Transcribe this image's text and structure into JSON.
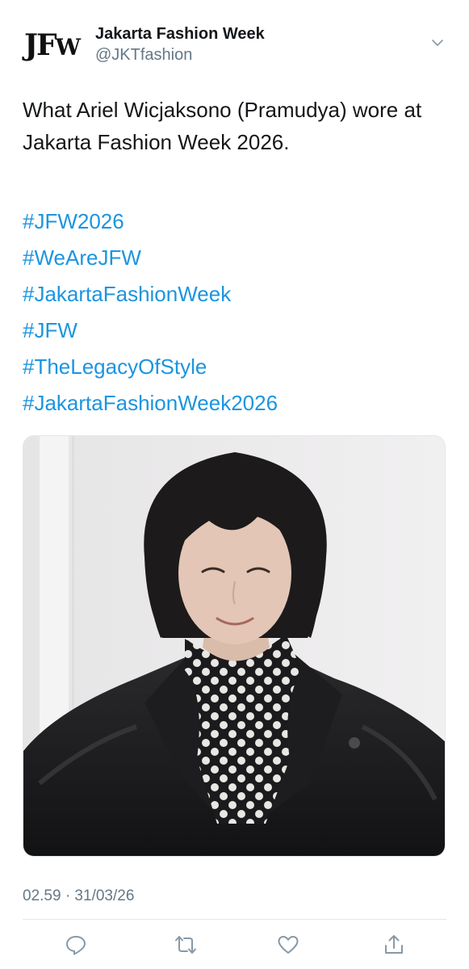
{
  "account": {
    "avatar_logo_big": "JF",
    "avatar_logo_small": "W",
    "display_name": "Jakarta Fashion Week",
    "handle": "@JKTfashion"
  },
  "tweet": {
    "text": "What Ariel Wicjaksono (Pramudya) wore at Jakarta Fashion Week 2026.",
    "hashtags": [
      "#JFW2026",
      "#WeAreJFW",
      "#JakartaFashionWeek",
      "#JFW",
      "#TheLegacyOfStyle",
      "#JakartaFashionWeek2026"
    ],
    "timestamp": "02.59 · 31/03/26"
  },
  "icons": {
    "menu": "chevron-down-icon",
    "reply": "reply-icon",
    "retweet": "retweet-icon",
    "like": "heart-icon",
    "share": "share-icon"
  },
  "colors": {
    "link": "#1b95e0",
    "secondary": "#657786",
    "text": "#14171a",
    "divider": "#e1e8ed"
  }
}
